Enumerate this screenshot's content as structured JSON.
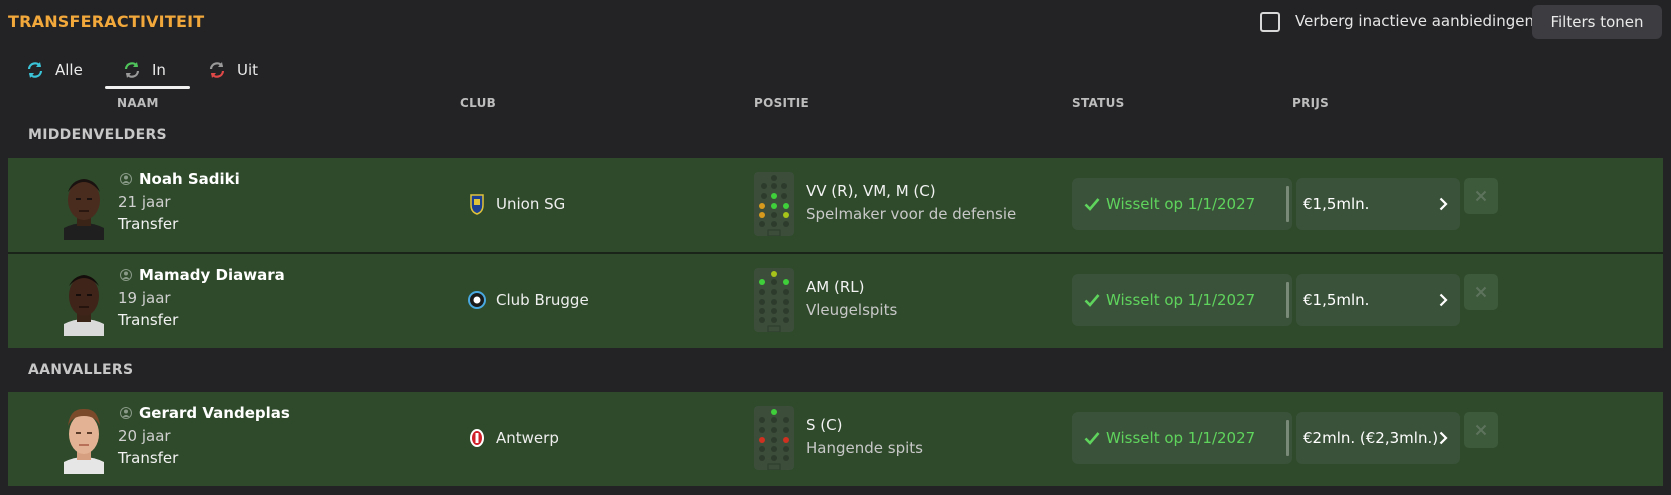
{
  "header": {
    "title": "TRANSFERACTIVITEIT",
    "checkbox_label": "Verberg inactieve aanbiedingen",
    "checkbox_checked": false,
    "filters_button": "Filters tonen"
  },
  "tabs": [
    {
      "label": "Alle",
      "icon": "transfer-both-icon",
      "active": false
    },
    {
      "label": "In",
      "icon": "transfer-in-icon",
      "active": true
    },
    {
      "label": "Uit",
      "icon": "transfer-out-icon",
      "active": false
    }
  ],
  "columns": {
    "naam": "NAAM",
    "club": "CLUB",
    "positie": "POSITIE",
    "status": "STATUS",
    "prijs": "PRIJS"
  },
  "groups": [
    {
      "label": "MIDDENVELDERS",
      "players": [
        {
          "name": "Noah Sadiki",
          "age": "21 jaar",
          "type": "Transfer",
          "club": "Union SG",
          "position": "VV (R), VM, M (C)",
          "role": "Spelmaker voor de defensie",
          "status": "Wisselt op 1/1/2027",
          "price": "€1,5mln."
        },
        {
          "name": "Mamady Diawara",
          "age": "19 jaar",
          "type": "Transfer",
          "club": "Club Brugge",
          "position": "AM (RL)",
          "role": "Vleugelspits",
          "status": "Wisselt op 1/1/2027",
          "price": "€1,5mln."
        }
      ]
    },
    {
      "label": "AANVALLERS",
      "players": [
        {
          "name": "Gerard Vandeplas",
          "age": "20 jaar",
          "type": "Transfer",
          "club": "Antwerp",
          "position": "S (C)",
          "role": "Hangende spits",
          "status": "Wisselt op 1/1/2027",
          "price": "€2mln. (€2,3mln.)"
        }
      ]
    }
  ],
  "colors": {
    "title": "#f2a83b",
    "row_bg": "#2e4a2a",
    "status_text": "#5fd45d",
    "background": "#232326"
  }
}
